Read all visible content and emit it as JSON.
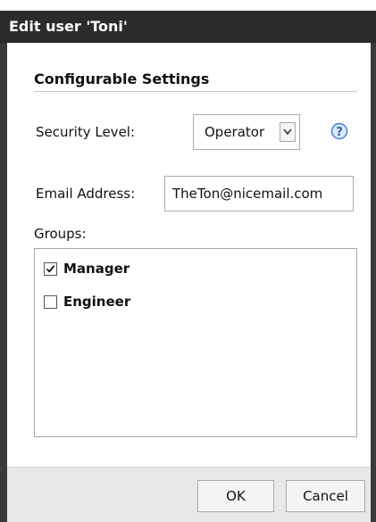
{
  "dialog": {
    "title": "Edit user 'Toni'"
  },
  "section": {
    "title": "Configurable Settings"
  },
  "security_level": {
    "label": "Security Level:",
    "value": "Operator"
  },
  "email": {
    "label": "Email Address:",
    "value": "TheTon@nicemail.com"
  },
  "groups": {
    "label": "Groups:",
    "items": [
      {
        "label": "Manager",
        "checked": true
      },
      {
        "label": "Engineer",
        "checked": false
      }
    ]
  },
  "buttons": {
    "ok": "OK",
    "cancel": "Cancel"
  },
  "icons": {
    "help": "help-icon",
    "dropdown": "chevron-down-icon",
    "check": "checkmark-icon"
  },
  "colors": {
    "title_bar": "#2b2b2b",
    "footer": "#e8e8e8",
    "help_icon": "#4a7fd4"
  }
}
